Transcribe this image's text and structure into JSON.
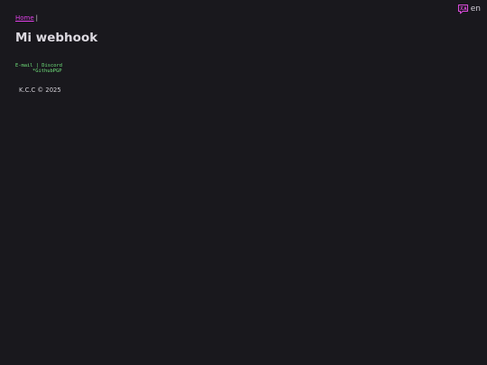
{
  "language": {
    "icon": "translate-icon",
    "label": "en",
    "accent_color": "#d84ad8"
  },
  "breadcrumb": {
    "home_label": "Home",
    "separator": "|",
    "link_color": "#e040e8"
  },
  "page": {
    "title": "Mi webhook"
  },
  "links": {
    "email": "E-mail",
    "separator": "|",
    "discord": "Discord",
    "github": "*GithubPGP",
    "text_color": "#6fe07a"
  },
  "footer": {
    "text": "K.C.C © 2025"
  },
  "colors": {
    "background": "#19181d",
    "text": "#d8d6dc"
  }
}
